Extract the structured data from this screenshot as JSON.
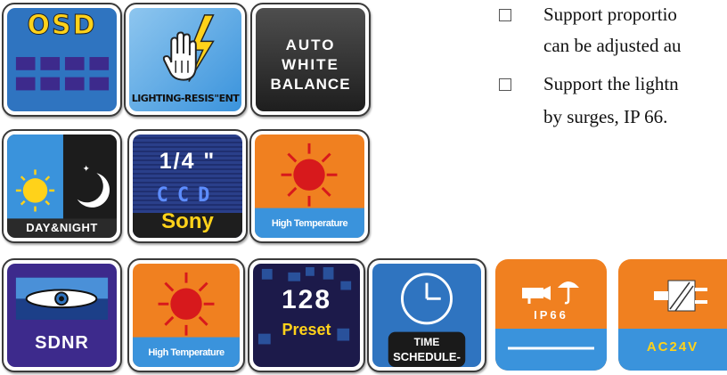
{
  "badges": {
    "osd": {
      "label": "OSD"
    },
    "lighting": {
      "label": "LIGHTING-RESIS\"ENT"
    },
    "awb": {
      "line1": "AUTO",
      "line2": "WHITE",
      "line3": "BALANCE"
    },
    "daynight": {
      "label": "DAY&NIGHT"
    },
    "ccd": {
      "size": "1/4 \"",
      "ccd": "CCD",
      "brand": "Sony"
    },
    "high_temp_1": {
      "label": "High Temperature"
    },
    "sdnr": {
      "label": "SDNR"
    },
    "high_temp_2": {
      "label": "High Temperature"
    },
    "preset": {
      "number": "128",
      "label": "Preset"
    },
    "schedule": {
      "line1": "TIME",
      "line2": "SCHEDULE-"
    },
    "ip66": {
      "label": "IP66"
    },
    "ac24v": {
      "label": "AC24V"
    }
  },
  "bullets": [
    {
      "line1": "Support proportio",
      "line2": "can be adjusted au"
    },
    {
      "line1": "Support the lightn",
      "line2": "by surges, IP 66."
    }
  ],
  "colors": {
    "blue": "#2f74c0",
    "light_blue": "#3a93dc",
    "orange": "#f08020",
    "purple": "#3d2a8c",
    "dark": "#222222",
    "yellow": "#ffd21a"
  }
}
